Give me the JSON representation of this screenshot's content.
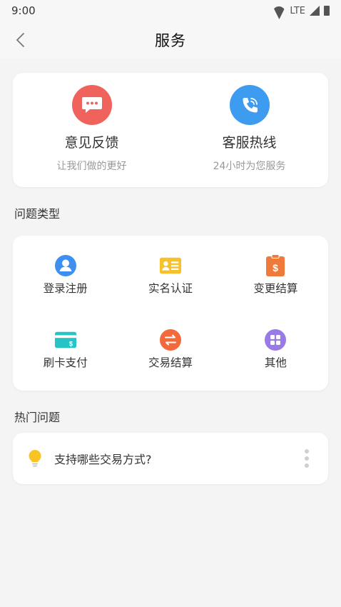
{
  "status_bar": {
    "time": "9:00",
    "network": "LTE"
  },
  "header": {
    "title": "服务"
  },
  "top_actions": [
    {
      "title": "意见反馈",
      "subtitle": "让我们做的更好",
      "icon": "chat-bubble-icon",
      "color": "#f0635c"
    },
    {
      "title": "客服热线",
      "subtitle": "24小时为您服务",
      "icon": "phone-icon",
      "color": "#3d9bf0"
    }
  ],
  "categories_section": {
    "label": "问题类型"
  },
  "categories": [
    {
      "label": "登录注册",
      "icon": "user-icon",
      "color": "#3d8ff0"
    },
    {
      "label": "实名认证",
      "icon": "id-card-icon",
      "color": "#f6c12a"
    },
    {
      "label": "变更结算",
      "icon": "dollar-clipboard-icon",
      "color": "#f07a3b"
    },
    {
      "label": "刷卡支付",
      "icon": "card-icon",
      "color": "#26c3c7"
    },
    {
      "label": "交易结算",
      "icon": "exchange-icon",
      "color": "#f26a3c"
    },
    {
      "label": "其他",
      "icon": "apps-icon",
      "color": "#9a7ae6"
    }
  ],
  "hot_section": {
    "label": "热门问题"
  },
  "hot_questions": [
    {
      "text": "支持哪些交易方式?",
      "icon": "lightbulb-icon"
    }
  ]
}
